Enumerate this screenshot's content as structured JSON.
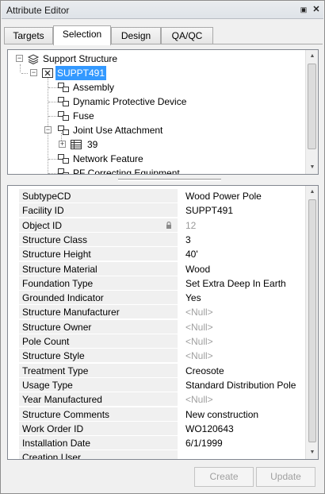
{
  "window": {
    "title": "Attribute Editor"
  },
  "tabs": [
    {
      "label": "Targets"
    },
    {
      "label": "Selection"
    },
    {
      "label": "Design"
    },
    {
      "label": "QA/QC"
    }
  ],
  "tree": {
    "root": "Support Structure",
    "selected": "SUPPT491",
    "children": [
      {
        "label": "Assembly"
      },
      {
        "label": "Dynamic Protective Device"
      },
      {
        "label": "Fuse"
      },
      {
        "label": "Joint Use Attachment"
      },
      {
        "label": "39"
      },
      {
        "label": "Network Feature"
      },
      {
        "label": "PF Correcting Equipment"
      }
    ]
  },
  "properties": [
    {
      "name": "SubtypeCD",
      "value": "Wood Power Pole"
    },
    {
      "name": "Facility ID",
      "value": "SUPPT491"
    },
    {
      "name": "Object ID",
      "value": "12"
    },
    {
      "name": "Structure Class",
      "value": "3"
    },
    {
      "name": "Structure Height",
      "value": "40'"
    },
    {
      "name": "Structure Material",
      "value": "Wood"
    },
    {
      "name": "Foundation Type",
      "value": "Set Extra Deep In Earth"
    },
    {
      "name": "Grounded Indicator",
      "value": "Yes"
    },
    {
      "name": "Structure Manufacturer",
      "value": "<Null>"
    },
    {
      "name": "Structure Owner",
      "value": "<Null>"
    },
    {
      "name": "Pole Count",
      "value": "<Null>"
    },
    {
      "name": "Structure Style",
      "value": "<Null>"
    },
    {
      "name": "Treatment Type",
      "value": "Creosote"
    },
    {
      "name": "Usage Type",
      "value": "Standard Distribution Pole"
    },
    {
      "name": "Year Manufactured",
      "value": "<Null>"
    },
    {
      "name": "Structure Comments",
      "value": "New construction"
    },
    {
      "name": "Work Order ID",
      "value": "WO120643"
    },
    {
      "name": "Installation Date",
      "value": "6/1/1999"
    },
    {
      "name": "Creation User",
      "value": ""
    }
  ],
  "buttons": {
    "create": "Create",
    "update": "Update"
  }
}
